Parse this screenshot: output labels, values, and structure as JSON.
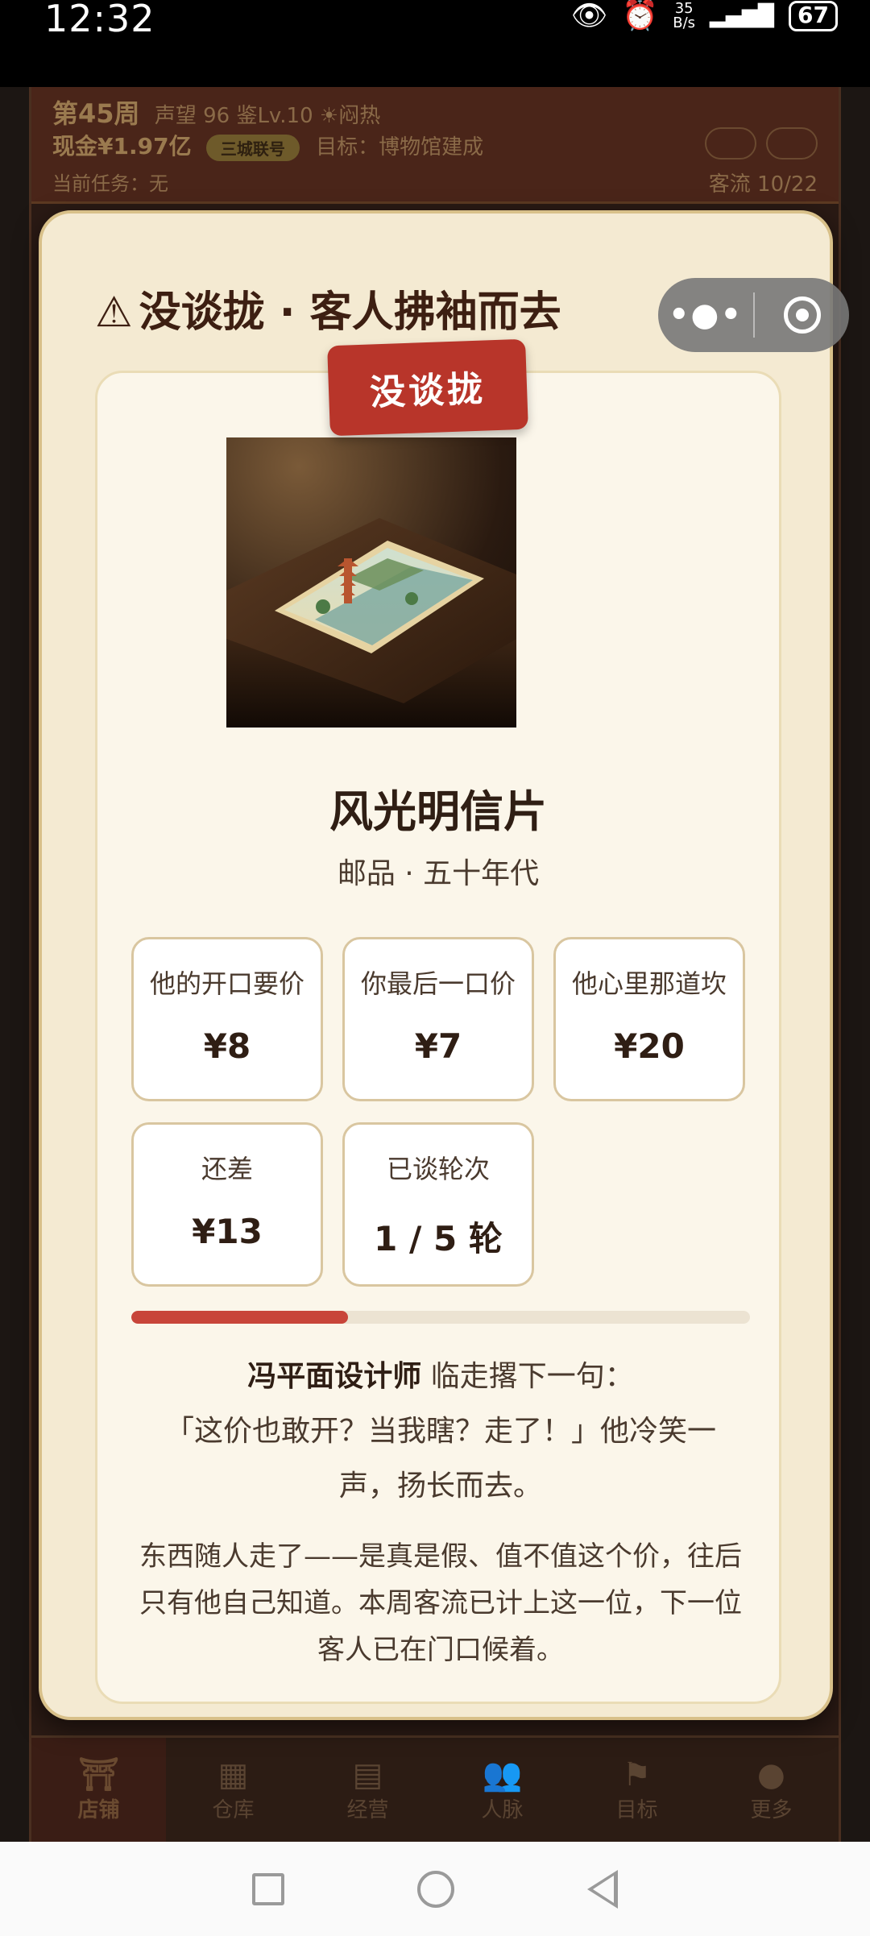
{
  "status_bar": {
    "time": "12:32",
    "net_speed_value": "35",
    "net_speed_unit": "B/s",
    "battery": "67",
    "icons": [
      "eye-icon",
      "alarm-icon",
      "signal-icon",
      "battery-icon"
    ]
  },
  "header": {
    "week": "第45周",
    "reputation": "声望 96",
    "appraisal_level": "鉴Lv.10",
    "heat": "闷热",
    "cash": "现金¥1.97亿",
    "union_badge": "三城联号",
    "goal": "目标：博物馆建成",
    "current_task": "当前任务：无",
    "traffic": "客流 10/22"
  },
  "tabs": [
    {
      "label": "店铺",
      "icon": "shop-icon",
      "active": true
    },
    {
      "label": "仓库",
      "icon": "warehouse-icon",
      "active": false
    },
    {
      "label": "经营",
      "icon": "business-icon",
      "active": false
    },
    {
      "label": "人脉",
      "icon": "contacts-icon",
      "active": false
    },
    {
      "label": "目标",
      "icon": "goal-icon",
      "active": false
    },
    {
      "label": "更多",
      "icon": "more-icon",
      "active": false
    }
  ],
  "modal": {
    "warning_icon": "⚠",
    "title": "没谈拢 · 客人拂袖而去",
    "stamp": "没谈拢",
    "item": {
      "name": "风光明信片",
      "meta": "邮品 · 五十年代",
      "image": "postcard-pagoda-image"
    },
    "stats": [
      {
        "label": "他的开口要价",
        "value": "¥8"
      },
      {
        "label": "你最后一口价",
        "value": "¥7"
      },
      {
        "label": "他心里那道坎",
        "value": "¥20"
      },
      {
        "label": "还差",
        "value": "¥13"
      },
      {
        "label": "已谈轮次",
        "value": "1 / 5 轮"
      }
    ],
    "rounds_progress": 0.35,
    "quote": {
      "speaker": "冯平面设计师",
      "lead": " 临走撂下一句：",
      "text": "「这价也敢开？当我瞎？走了！」他冷笑一声，扬长而去。"
    },
    "narration": "东西随人走了——是真是假、值不值这个价，往后只有他自己知道。本周客流已计上这一位，下一位客人已在门口候着。"
  },
  "colors": {
    "accent_red": "#b8352a",
    "modal_bg": "#f4ead2",
    "title_brown": "#3d1f12"
  }
}
